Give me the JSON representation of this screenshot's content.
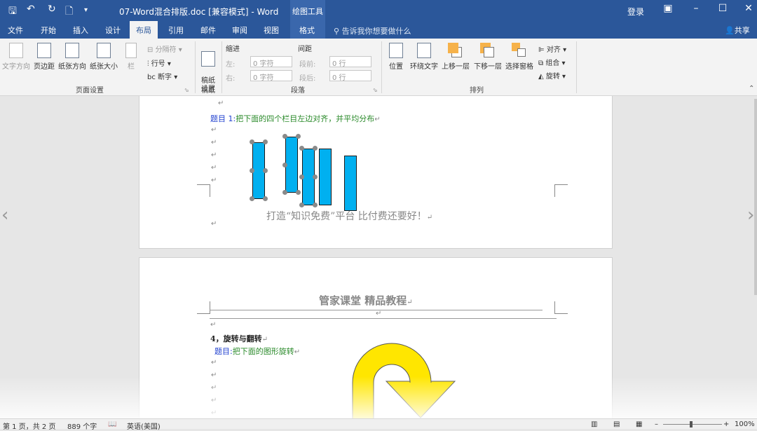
{
  "titlebar": {
    "title": "07-Word混合排版.doc [兼容模式]  -  Word",
    "drawing_tools": "绘图工具",
    "login": "登录"
  },
  "tabs": [
    "文件",
    "开始",
    "插入",
    "设计",
    "布局",
    "引用",
    "邮件",
    "审阅",
    "视图"
  ],
  "active_tab": "布局",
  "format_tab": "格式",
  "tell_me": "告诉我你想要做什么",
  "share": "共享",
  "ribbon": {
    "page_setup": {
      "label": "页面设置",
      "text_direction": "文字方向",
      "margins": "页边距",
      "orientation": "纸张方向",
      "size": "纸张大小",
      "columns": "栏",
      "breaks": "分隔符",
      "line_numbers": "行号",
      "hyphenation": "断字"
    },
    "draft": {
      "label": "稿纸",
      "button": "稿纸\n设置"
    },
    "paragraph": {
      "label": "段落",
      "indent_title": "缩进",
      "spacing_title": "间距",
      "left": "左:",
      "right": "右:",
      "before": "段前:",
      "after": "段后:",
      "left_value": "0 字符",
      "right_value": "0 字符",
      "before_value": "0 行",
      "after_value": "0 行"
    },
    "arrange": {
      "label": "排列",
      "position": "位置",
      "wrap_text": "环绕文字",
      "bring_forward": "上移一层",
      "send_backward": "下移一层",
      "selection_pane": "选择窗格",
      "align": "对齐",
      "group": "组合",
      "rotate": "旋转"
    }
  },
  "document": {
    "page1": {
      "question_prefix": "题目 1:",
      "question_text": "把下面的四个栏目左边对齐，并平均分布",
      "footer": "打造“知识免费”平台   比付费还要好！"
    },
    "page2": {
      "header": "管家课堂    精品教程",
      "section": "4，旋转与翻转",
      "question_prefix": "题目:",
      "question_text": "把下面的图形旋转"
    }
  },
  "statusbar": {
    "page_info": "第 1 页，共 2 页",
    "word_count": "889 个字",
    "language": "英语(美国)",
    "zoom": "100%"
  },
  "colors": {
    "accent": "#2b579a",
    "shape_fill": "#00b0f0",
    "arrow_fill": "#ffe600"
  }
}
